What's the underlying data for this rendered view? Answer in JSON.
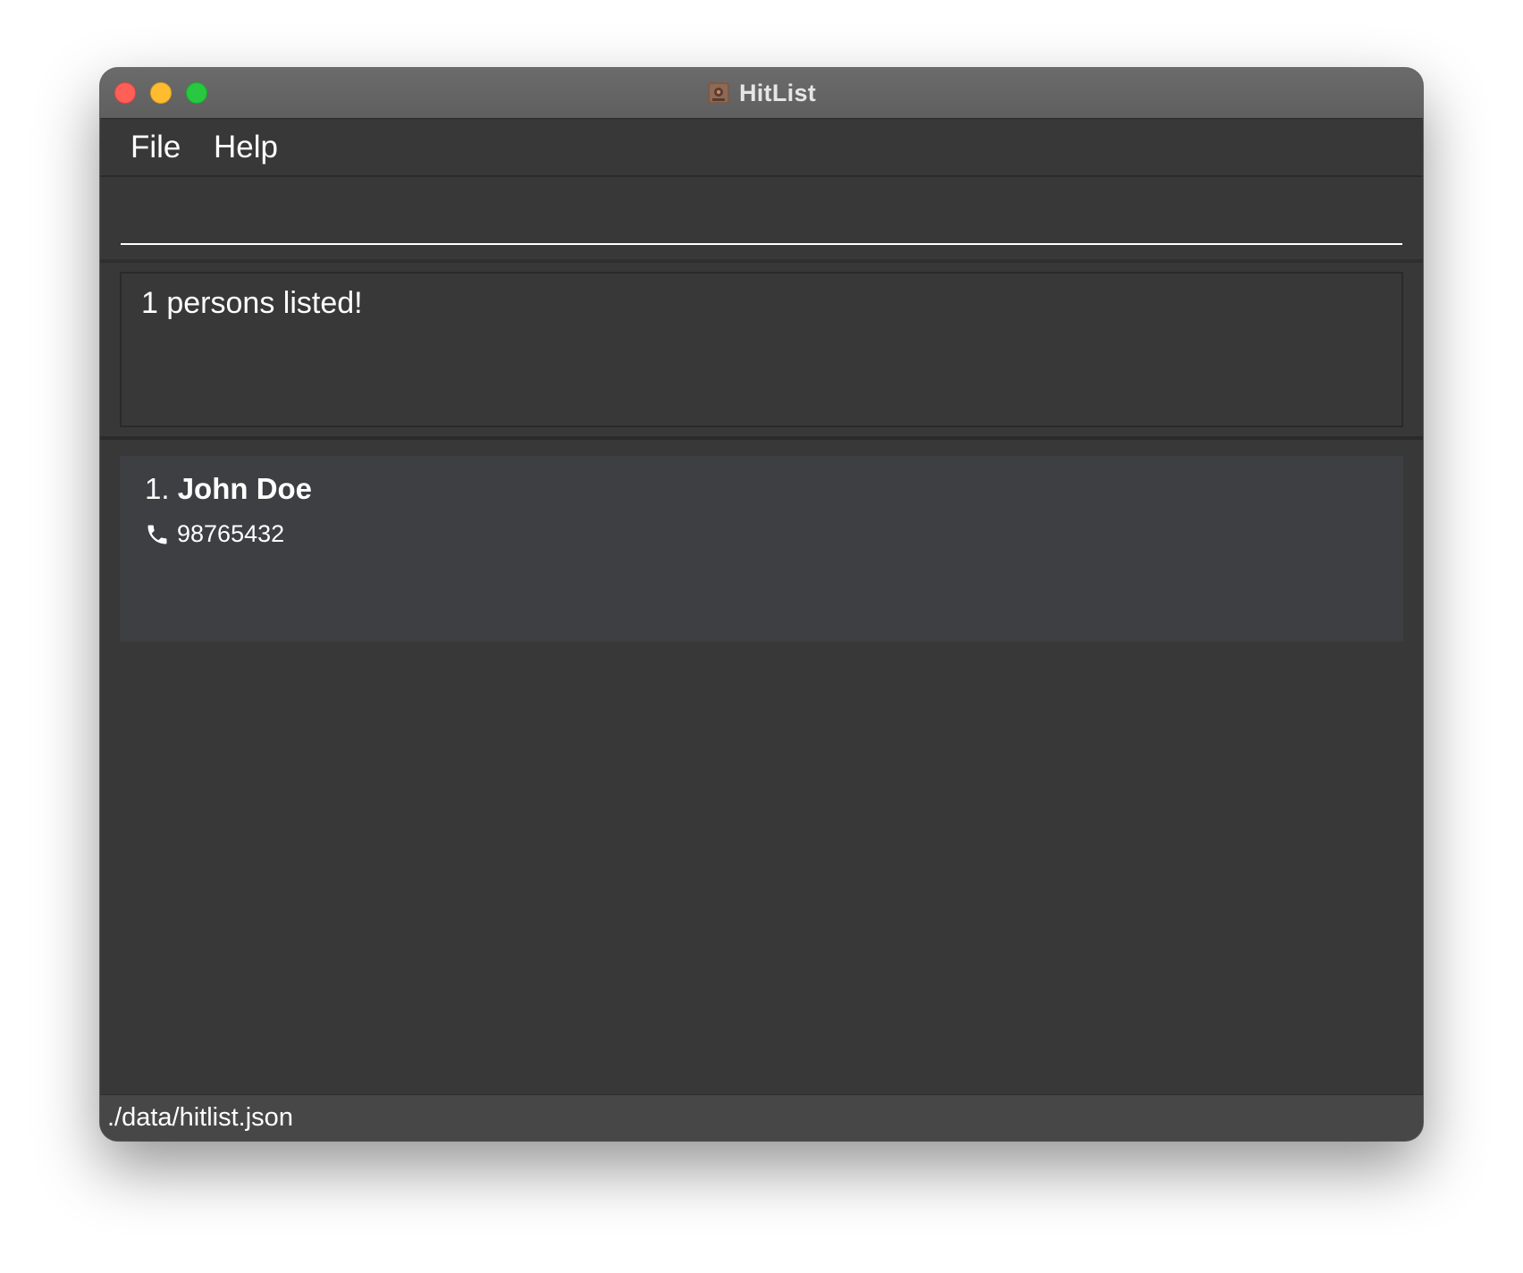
{
  "window": {
    "title": "HitList",
    "app_icon": "hitlist-app-icon"
  },
  "menu": {
    "items": [
      {
        "label": "File"
      },
      {
        "label": "Help"
      }
    ]
  },
  "command_box": {
    "value": "",
    "placeholder": ""
  },
  "result_display": {
    "text": "1 persons listed!"
  },
  "person_list": {
    "items": [
      {
        "index": "1. ",
        "name": "John Doe",
        "phone_icon": "phone-icon",
        "phone": "98765432"
      }
    ]
  },
  "status_bar": {
    "file_path": "./data/hitlist.json"
  },
  "colors": {
    "window_bg": "#383838",
    "card_bg": "#3e3f42",
    "statusbar_bg": "#474747",
    "titlebar_bg": "#636363",
    "close": "#fe5f57",
    "minimize": "#febc2e",
    "maximize": "#28c840"
  }
}
